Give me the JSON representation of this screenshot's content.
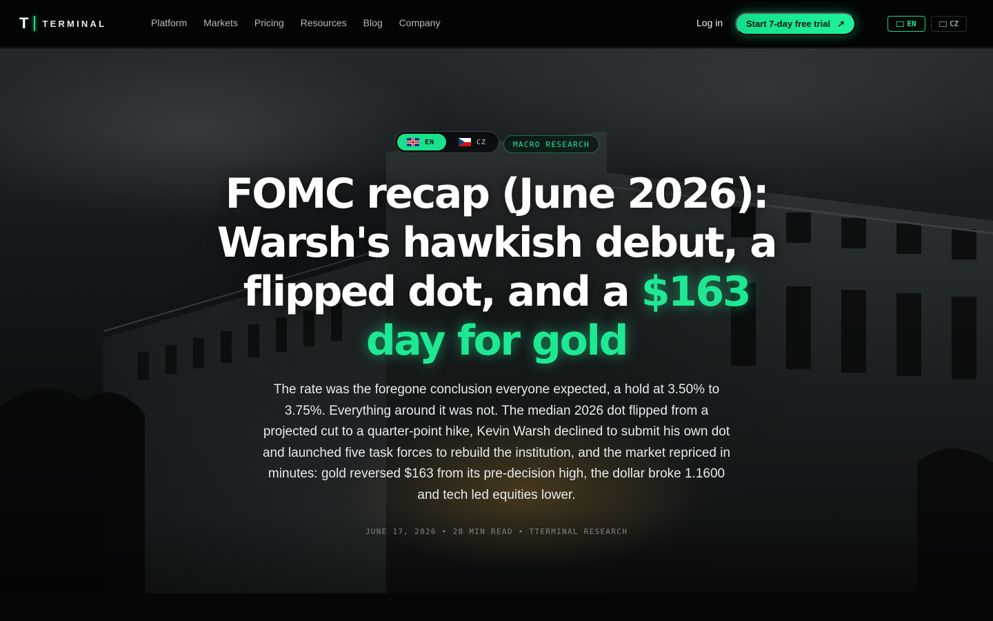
{
  "nav": {
    "brand_letter": "T",
    "brand_word": "TERMINAL",
    "links": [
      "Platform",
      "Markets",
      "Pricing",
      "Resources",
      "Blog",
      "Company"
    ],
    "login": "Log in",
    "trial_label": "Start 7-day free trial",
    "trial_icon": "↗",
    "lang_en": "EN",
    "lang_cz": "CZ"
  },
  "hero": {
    "lang_switch": {
      "en": "EN",
      "cz": "CZ",
      "active": "EN"
    },
    "category": "MACRO RESEARCH",
    "headline_part1": "FOMC recap (June 2026): Warsh's hawkish debut, a flipped dot, and a ",
    "headline_highlight": "$163 day for gold",
    "lede": "The rate was the foregone conclusion everyone expected, a hold at 3.50% to 3.75%. Everything around it was not. The median 2026 dot flipped from a projected cut to a quarter-point hike, Kevin Warsh declined to submit his own dot and launched five task forces to rebuild the institution, and the market repriced in minutes: gold reversed $163 from its pre-decision high, the dollar broke 1.1600 and tech led equities lower.",
    "meta": "JUNE 17, 2026 • 28 MIN READ • TTERMINAL RESEARCH"
  },
  "colors": {
    "accent": "#1fe893",
    "background": "#050607"
  }
}
